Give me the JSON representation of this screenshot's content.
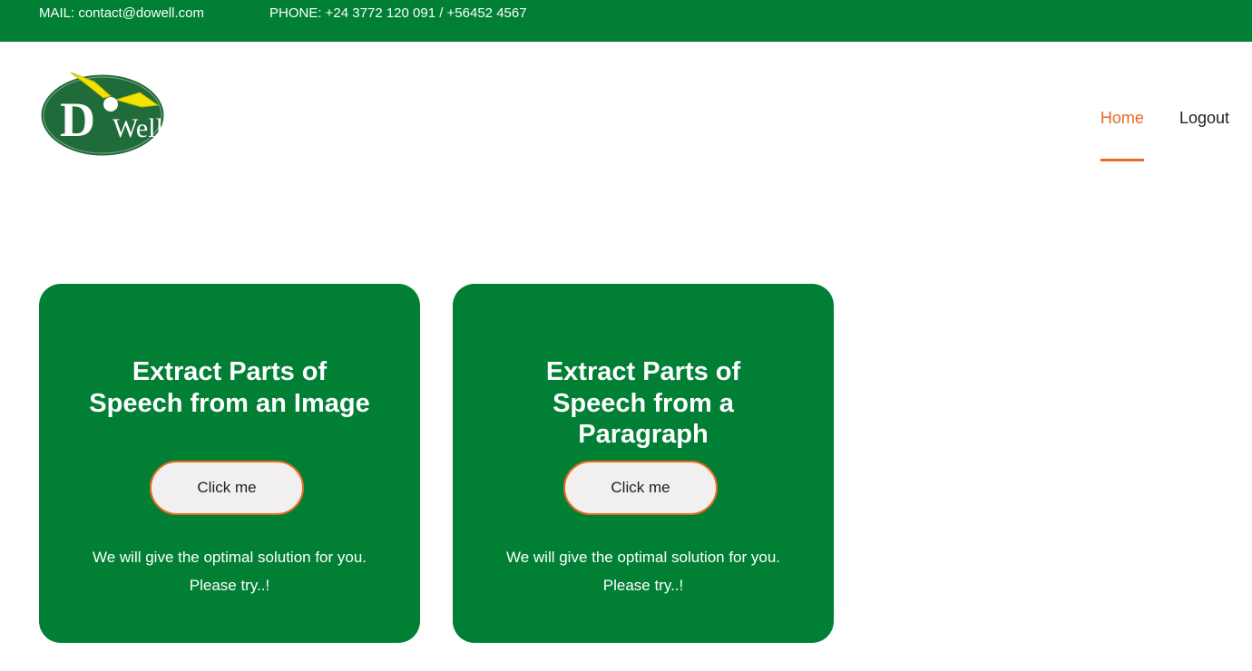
{
  "topbar": {
    "mail": "MAIL: contact@dowell.com",
    "phone": "PHONE: +24 3772 120 091 / +56452 4567"
  },
  "logo": {
    "letter": "D",
    "word": "Well"
  },
  "nav": {
    "items": [
      {
        "label": "Home",
        "active": true
      },
      {
        "label": "Logout",
        "active": false
      }
    ]
  },
  "cards": [
    {
      "title": "Extract Parts of Speech from an Image",
      "button": "Click me",
      "text": "We will give the optimal solution for you. Please try..!"
    },
    {
      "title": "Extract Parts of Speech from a Paragraph",
      "button": "Click me",
      "text": "We will give the optimal solution for you. Please try..!"
    }
  ],
  "colors": {
    "brand_green": "#007f35",
    "accent_orange": "#ea6a1f",
    "button_bg": "#f1efef",
    "logo_yellow": "#f2e400",
    "logo_green": "#1f6b3a"
  }
}
